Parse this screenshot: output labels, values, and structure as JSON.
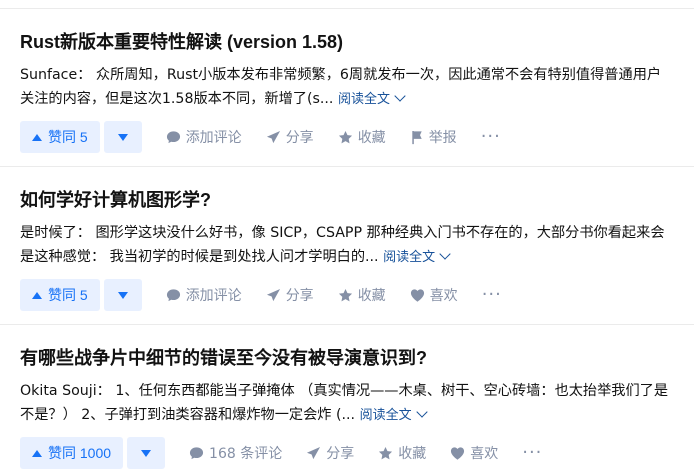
{
  "colors": {
    "accent": "#1772f6",
    "vote_bg": "#e8f0ff",
    "meta": "#8590a6",
    "link": "#175199"
  },
  "cards": [
    {
      "title": "Rust新版本重要特性解读 (version 1.58)",
      "author": "Sunface：",
      "excerpt_line1": "众所周知，Rust小版本发布非常频繁，6周就发布一次，因此通常不会有特别值得普通",
      "excerpt_line2": "用户关注的内容，但是这次1.58版本不同，新增了(s...",
      "read_more": "阅读全文",
      "vote_label": "赞同 5",
      "comment_label": "添加评论",
      "share_label": "分享",
      "collect_label": "收藏",
      "extra_label": "举报",
      "extra_icon": "flag-icon"
    },
    {
      "title": "如何学好计算机图形学?",
      "author": "",
      "excerpt_line1": "是时候了： 图形学这块没什么好书，像 SICP，CSAPP 那种经典入门书不存在的，大部分书你看起",
      "excerpt_line2": "来会是这种感觉： 我当初学的时候是到处找人问才学明白的...",
      "read_more": "阅读全文",
      "vote_label": "赞同 5",
      "comment_label": "添加评论",
      "share_label": "分享",
      "collect_label": "收藏",
      "extra_label": "喜欢",
      "extra_icon": "heart-icon"
    },
    {
      "title": "有哪些战争片中细节的错误至今没有被导演意识到?",
      "author": "Okita Souji：",
      "excerpt_line1": "1、任何东西都能当子弹掩体 （真实情况——木桌、树干、空心砖墙：也太抬举我们",
      "excerpt_line2": "了是不是？） 2、子弹打到油类容器和爆炸物一定会炸 (...",
      "read_more": "阅读全文",
      "vote_label": "赞同 1000",
      "comment_label": "168 条评论",
      "share_label": "分享",
      "collect_label": "收藏",
      "extra_label": "喜欢",
      "extra_icon": "heart-icon"
    }
  ]
}
